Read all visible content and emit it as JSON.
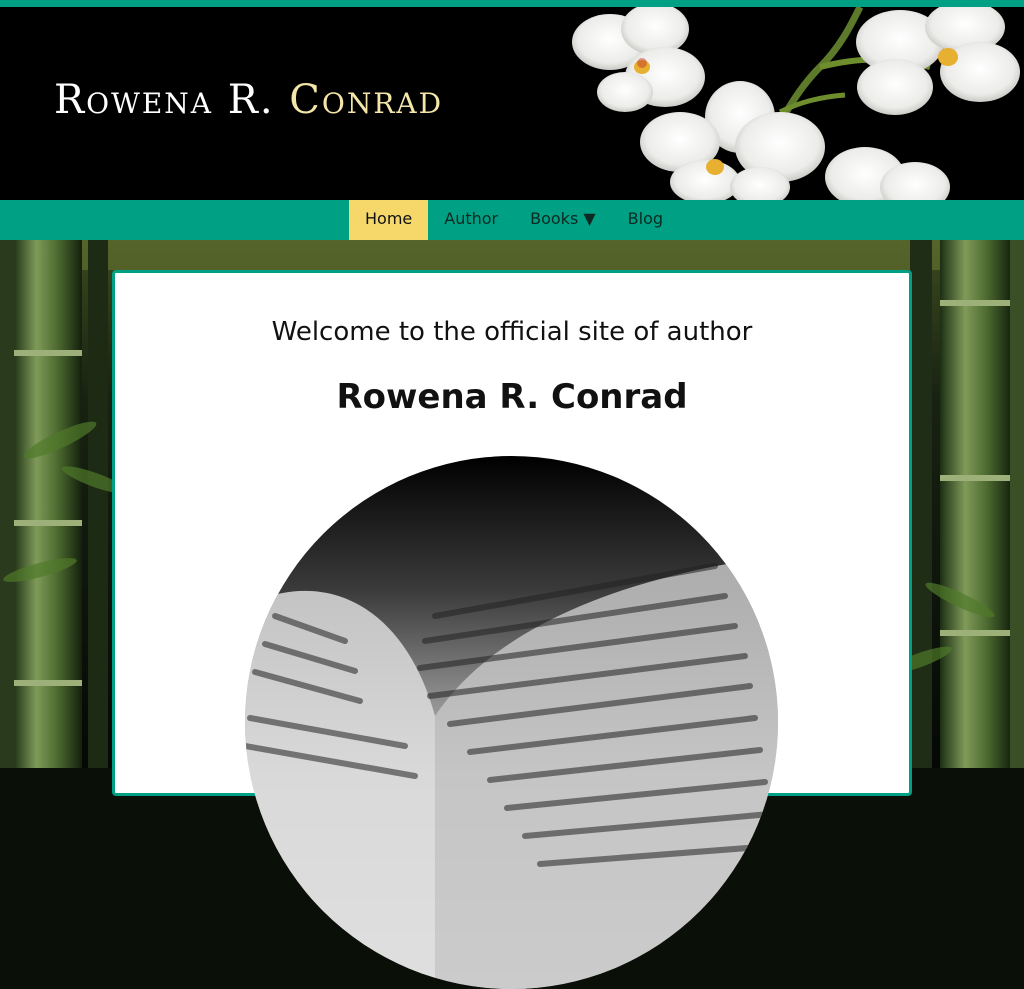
{
  "site": {
    "title_first": "Rowena R.",
    "title_last": "Conrad"
  },
  "nav": {
    "items": [
      {
        "label": "Home",
        "active": true
      },
      {
        "label": "Author",
        "active": false
      },
      {
        "label": "Books ▼",
        "active": false
      },
      {
        "label": "Blog",
        "active": false
      }
    ]
  },
  "main": {
    "welcome": "Welcome to the official site of author",
    "author_name": "Rowena R. Conrad"
  },
  "colors": {
    "accent": "#00a085",
    "active_nav": "#f5d76a",
    "header_bg": "#000000",
    "title_highlight": "#f3e6a8"
  },
  "images": {
    "header": "white-orchid-flowers",
    "background": "bamboo-forest",
    "hero": "open-book-pages"
  }
}
